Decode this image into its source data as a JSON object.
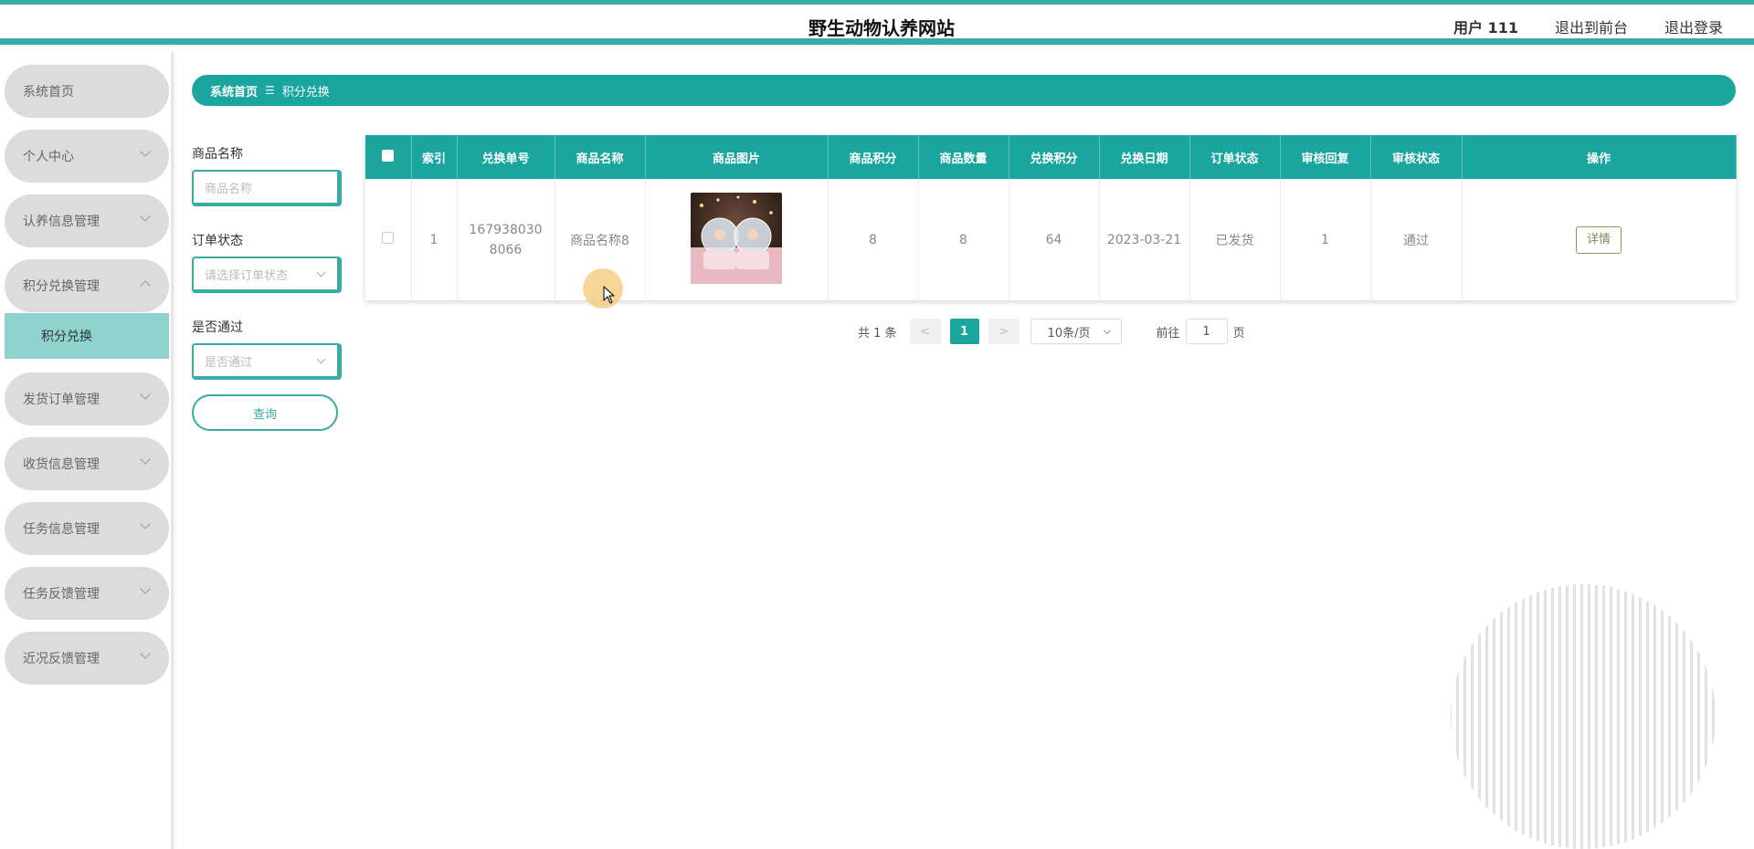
{
  "header": {
    "title": "野生动物认养网站",
    "user": "用户 111",
    "front_link": "退出到前台",
    "logout_link": "退出登录"
  },
  "sidebar": {
    "items": [
      {
        "label": "系统首页"
      },
      {
        "label": "个人中心"
      },
      {
        "label": "认养信息管理"
      },
      {
        "label": "积分兑换管理"
      },
      {
        "label": "积分兑换"
      },
      {
        "label": "发货订单管理"
      },
      {
        "label": "收货信息管理"
      },
      {
        "label": "任务信息管理"
      },
      {
        "label": "任务反馈管理"
      },
      {
        "label": "近况反馈管理"
      }
    ]
  },
  "breadcrumb": {
    "home": "系统首页",
    "separator": "☰",
    "current": "积分兑换"
  },
  "filters": {
    "name_label": "商品名称",
    "name_placeholder": "商品名称",
    "status_label": "订单状态",
    "status_placeholder": "请选择订单状态",
    "pass_label": "是否通过",
    "pass_placeholder": "是否通过",
    "query_button": "查询"
  },
  "table": {
    "columns": [
      "索引",
      "兑换单号",
      "商品名称",
      "商品图片",
      "商品积分",
      "商品数量",
      "兑换积分",
      "兑换日期",
      "订单状态",
      "审核回复",
      "审核状态",
      "操作"
    ],
    "rows": [
      {
        "index": "1",
        "order_no": "1679380308066",
        "name": "商品名称8",
        "points": "8",
        "quantity": "8",
        "exchange_points": "64",
        "date": "2023-03-21",
        "order_status": "已发货",
        "review_reply": "1",
        "review_status": "通过",
        "action": "详情"
      }
    ]
  },
  "pagination": {
    "total": "共 1 条",
    "prev": "<",
    "page": "1",
    "next": ">",
    "page_size": "10条/页",
    "goto_label": "前往",
    "goto_value": "1",
    "page_suffix": "页"
  },
  "colors": {
    "accent": "#1aa59f",
    "accent_light": "#8fd3cf",
    "menu_bg": "#dcdcdc"
  }
}
